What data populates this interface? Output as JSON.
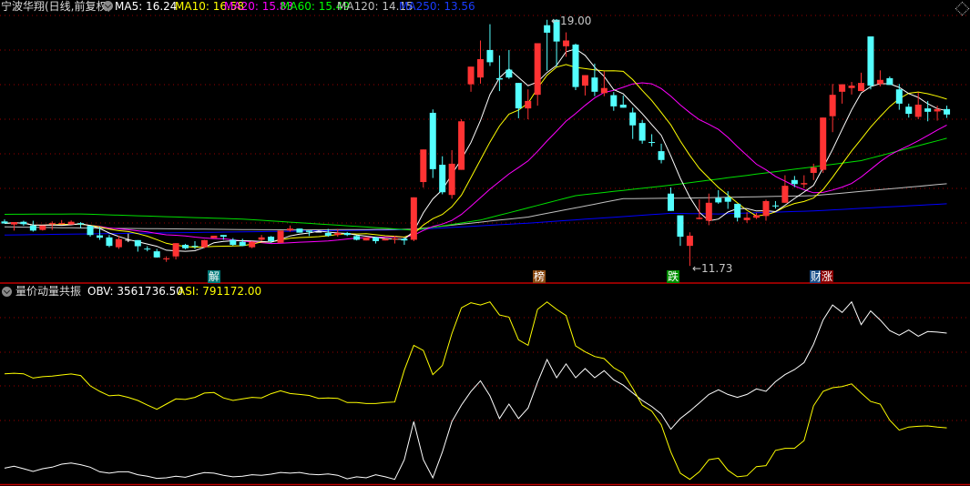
{
  "header": {
    "title": "宁波华翔(日线,前复权)",
    "ma_labels": [
      {
        "text": "MA5: 16.24",
        "color": "#ffffff"
      },
      {
        "text": "MA10: 16.58",
        "color": "#ffff00"
      },
      {
        "text": "MA20: 15.83",
        "color": "#ff00ff"
      },
      {
        "text": "MA60: 15.49",
        "color": "#00ff00"
      },
      {
        "text": "MA120: 14.15",
        "color": "#c0c0c0"
      },
      {
        "text": "MA250: 13.56",
        "color": "#0000ff"
      }
    ]
  },
  "indicator": {
    "title": "量价动量共振",
    "obv_label": "OBV: 3561736.50",
    "asi_label": "ASI: 791172.00"
  },
  "markers": {
    "high_label": "←19.00",
    "low_label": "←11.73",
    "badges": [
      {
        "text": "解",
        "bg": "#007a7a"
      },
      {
        "text": "榜",
        "bg": "#8b4a12"
      },
      {
        "text": "跌",
        "bg": "#009000"
      },
      {
        "text": "财",
        "bg": "#1a4f8a"
      },
      {
        "text": "涨",
        "bg": "#8b0000"
      }
    ]
  },
  "colors": {
    "up": "#ff3333",
    "down": "#54ffff",
    "flat": "#ffffff",
    "grid": "#9a0000",
    "separator": "#c00000"
  },
  "chart_data": [
    {
      "type": "candlestick",
      "title": "宁波华翔(日线,前复权)",
      "price_range": [
        11.73,
        19.0
      ],
      "high": 19.0,
      "low": 11.73,
      "ohlc": [
        [
          13.04,
          13.1,
          12.98,
          12.98
        ],
        [
          12.95,
          13.02,
          12.77,
          13.02
        ],
        [
          13.03,
          13.06,
          12.91,
          12.96
        ],
        [
          12.92,
          13.06,
          12.74,
          12.77
        ],
        [
          12.79,
          12.92,
          12.77,
          12.92
        ],
        [
          12.96,
          13.04,
          12.79,
          12.99
        ],
        [
          12.98,
          13.08,
          12.95,
          12.99
        ],
        [
          12.95,
          13.07,
          12.95,
          13.03
        ],
        [
          12.99,
          13.02,
          12.84,
          12.95
        ],
        [
          12.91,
          12.91,
          12.59,
          12.64
        ],
        [
          12.63,
          12.88,
          12.5,
          12.56
        ],
        [
          12.57,
          12.64,
          12.28,
          12.32
        ],
        [
          12.28,
          12.61,
          12.23,
          12.52
        ],
        [
          12.5,
          12.68,
          12.43,
          12.5
        ],
        [
          12.49,
          12.49,
          12.15,
          12.31
        ],
        [
          12.24,
          12.31,
          12.16,
          12.23
        ],
        [
          12.16,
          12.23,
          11.97,
          11.98
        ],
        [
          11.93,
          12.01,
          11.85,
          11.95
        ],
        [
          12.01,
          12.4,
          11.92,
          12.4
        ],
        [
          12.35,
          12.38,
          12.22,
          12.25
        ],
        [
          12.32,
          12.46,
          12.23,
          12.3
        ],
        [
          12.28,
          12.5,
          12.25,
          12.49
        ],
        [
          12.55,
          12.62,
          12.55,
          12.62
        ],
        [
          12.64,
          12.64,
          12.5,
          12.59
        ],
        [
          12.5,
          12.55,
          12.32,
          12.35
        ],
        [
          12.44,
          12.53,
          12.31,
          12.32
        ],
        [
          12.28,
          12.46,
          12.25,
          12.44
        ],
        [
          12.5,
          12.64,
          12.46,
          12.57
        ],
        [
          12.59,
          12.61,
          12.41,
          12.46
        ],
        [
          12.41,
          12.77,
          12.41,
          12.77
        ],
        [
          12.77,
          12.92,
          12.74,
          12.83
        ],
        [
          12.83,
          12.83,
          12.71,
          12.71
        ],
        [
          12.77,
          12.77,
          12.61,
          12.73
        ],
        [
          12.74,
          12.77,
          12.72,
          12.74
        ],
        [
          12.7,
          12.82,
          12.59,
          12.62
        ],
        [
          12.64,
          12.82,
          12.59,
          12.7
        ],
        [
          12.7,
          12.73,
          12.61,
          12.64
        ],
        [
          12.61,
          12.64,
          12.48,
          12.5
        ],
        [
          12.48,
          12.57,
          12.48,
          12.57
        ],
        [
          12.57,
          12.59,
          12.39,
          12.46
        ],
        [
          12.48,
          12.53,
          12.48,
          12.53
        ],
        [
          12.52,
          12.62,
          12.39,
          12.54
        ],
        [
          12.53,
          12.57,
          12.35,
          12.48
        ],
        [
          12.5,
          13.75,
          12.46,
          13.75
        ],
        [
          14.2,
          15.16,
          14.04,
          15.16
        ],
        [
          16.24,
          16.34,
          14.32,
          14.58
        ],
        [
          14.71,
          14.96,
          13.84,
          13.9
        ],
        [
          13.82,
          15.14,
          13.71,
          14.74
        ],
        [
          14.56,
          16.05,
          14.56,
          15.99
        ],
        [
          17.08,
          17.6,
          16.86,
          17.6
        ],
        [
          17.28,
          18.37,
          17.1,
          17.82
        ],
        [
          18.09,
          18.85,
          17.62,
          17.73
        ],
        [
          17.26,
          17.93,
          16.88,
          17.22
        ],
        [
          17.51,
          18.09,
          17.24,
          17.28
        ],
        [
          17.12,
          17.12,
          16.08,
          16.37
        ],
        [
          16.37,
          16.93,
          16.05,
          16.59
        ],
        [
          16.77,
          18.29,
          16.45,
          18.29
        ],
        [
          18.82,
          18.98,
          17.48,
          18.6
        ],
        [
          18.98,
          19.0,
          17.6,
          18.34
        ],
        [
          18.2,
          18.61,
          17.89,
          18.37
        ],
        [
          18.25,
          18.28,
          16.91,
          17.0
        ],
        [
          17.04,
          17.35,
          16.75,
          17.35
        ],
        [
          17.28,
          17.69,
          16.73,
          16.86
        ],
        [
          16.82,
          17.46,
          16.73,
          16.97
        ],
        [
          16.76,
          16.85,
          16.3,
          16.43
        ],
        [
          16.48,
          16.75,
          16.39,
          16.39
        ],
        [
          16.25,
          16.39,
          15.47,
          15.87
        ],
        [
          15.94,
          16.03,
          15.33,
          15.42
        ],
        [
          15.38,
          15.61,
          15.25,
          15.36
        ],
        [
          15.11,
          15.33,
          14.75,
          14.85
        ],
        [
          13.86,
          14.04,
          13.35,
          13.35
        ],
        [
          13.22,
          13.22,
          12.32,
          12.59
        ],
        [
          12.32,
          12.72,
          11.73,
          12.62
        ],
        [
          13.11,
          13.69,
          13.1,
          13.15
        ],
        [
          13.06,
          13.86,
          12.93,
          13.59
        ],
        [
          13.73,
          13.96,
          13.56,
          13.6
        ],
        [
          13.75,
          13.93,
          13.41,
          13.62
        ],
        [
          13.56,
          13.56,
          13.04,
          13.15
        ],
        [
          13.08,
          13.31,
          13.0,
          13.15
        ],
        [
          13.15,
          13.29,
          13.11,
          13.22
        ],
        [
          13.2,
          13.68,
          13.06,
          13.64
        ],
        [
          13.51,
          13.64,
          13.42,
          13.49
        ],
        [
          13.59,
          14.4,
          13.59,
          14.09
        ],
        [
          14.26,
          14.38,
          14.05,
          14.14
        ],
        [
          14.13,
          14.4,
          14.02,
          14.17
        ],
        [
          14.47,
          14.74,
          14.26,
          14.63
        ],
        [
          14.56,
          16.1,
          14.47,
          16.1
        ],
        [
          16.14,
          17.09,
          15.67,
          16.77
        ],
        [
          16.86,
          17.08,
          16.51,
          17.08
        ],
        [
          16.97,
          17.15,
          16.78,
          17.04
        ],
        [
          16.88,
          17.42,
          16.88,
          17.12
        ],
        [
          18.49,
          18.49,
          16.93,
          17.04
        ],
        [
          17.09,
          17.49,
          17.02,
          17.21
        ],
        [
          17.26,
          17.31,
          17.06,
          17.06
        ],
        [
          16.93,
          17.09,
          16.33,
          16.51
        ],
        [
          16.42,
          16.51,
          16.1,
          16.21
        ],
        [
          16.12,
          16.84,
          16.05,
          16.48
        ],
        [
          16.37,
          16.59,
          15.99,
          16.27
        ],
        [
          16.28,
          16.45,
          16.01,
          16.35
        ],
        [
          16.35,
          16.45,
          16.09,
          16.19
        ]
      ],
      "ma_long": {
        "MA60": [
          [
            0,
            13.25
          ],
          [
            8,
            13.26
          ],
          [
            25,
            13.11
          ],
          [
            40,
            12.84
          ],
          [
            43,
            12.78
          ],
          [
            50,
            13.08
          ],
          [
            60,
            13.8
          ],
          [
            70,
            14.11
          ],
          [
            80,
            14.47
          ],
          [
            90,
            14.83
          ],
          [
            99,
            15.49
          ]
        ],
        "MA120": [
          [
            0,
            12.88
          ],
          [
            10,
            12.84
          ],
          [
            30,
            12.79
          ],
          [
            43,
            12.81
          ],
          [
            55,
            13.17
          ],
          [
            65,
            13.71
          ],
          [
            72,
            13.73
          ],
          [
            85,
            13.8
          ],
          [
            99,
            14.15
          ]
        ],
        "MA250": [
          [
            0,
            12.64
          ],
          [
            43,
            12.8
          ],
          [
            55,
            12.99
          ],
          [
            70,
            13.28
          ],
          [
            75,
            13.26
          ],
          [
            85,
            13.35
          ],
          [
            99,
            13.56
          ]
        ]
      }
    },
    {
      "type": "line",
      "title": "量价动量共振",
      "units": "relative level 0-100",
      "series": [
        {
          "name": "OBV",
          "color": "#ffffff",
          "values": [
            8.3,
            9.3,
            8,
            6.6,
            8,
            8.8,
            10.4,
            11,
            10.1,
            8.8,
            6.4,
            5.7,
            6.4,
            6.4,
            4.9,
            4.1,
            3,
            3.3,
            4.1,
            3.6,
            4.9,
            6,
            5.7,
            4.6,
            3.8,
            4.1,
            4.9,
            4.6,
            5.2,
            6.1,
            5.7,
            6.1,
            5.2,
            4.9,
            5.3,
            4.6,
            2.8,
            3.8,
            3.3,
            4.9,
            3.8,
            2.5,
            12.7,
            32.4,
            12.7,
            3.3,
            16.7,
            32.4,
            41,
            48,
            53.6,
            45.8,
            34,
            41.5,
            34,
            39.5,
            52.8,
            64.6,
            55.2,
            62.3,
            55.2,
            59.9,
            55.2,
            58.8,
            54.1,
            51.3,
            47.3,
            43.4,
            40.3,
            36.3,
            28.5,
            34,
            37.9,
            42.1,
            46.5,
            48.9,
            46.5,
            45,
            46.5,
            49.4,
            48.1,
            53.1,
            56.8,
            59.4,
            63,
            72.5,
            85.1,
            92.9,
            89,
            94.5,
            82.7,
            89.8,
            85.1,
            79.6,
            77.2,
            79.9,
            76.7,
            79.1,
            78.8,
            78.3
          ]
        },
        {
          "name": "ASI",
          "color": "#ffff00",
          "values": [
            57.2,
            57.5,
            57.2,
            55,
            55.7,
            56,
            56.6,
            57.1,
            56.3,
            51,
            48.1,
            45.8,
            46.2,
            45,
            43.4,
            41,
            38.8,
            41.5,
            44.2,
            43.9,
            45,
            47.2,
            47.5,
            44.7,
            43.4,
            44.2,
            45,
            44.7,
            46.9,
            48.4,
            47,
            46.5,
            46,
            44.5,
            44.7,
            44.5,
            42.3,
            42.3,
            41.8,
            41.8,
            42.3,
            42.6,
            59.1,
            72,
            69.3,
            56.8,
            61.5,
            78,
            91.4,
            94,
            92.9,
            94.5,
            87.7,
            86.6,
            74.8,
            72,
            90.6,
            94.5,
            90.6,
            87.4,
            71.7,
            68.6,
            66.2,
            65.1,
            60.4,
            57.5,
            49.7,
            41,
            37.9,
            30.8,
            16.7,
            5.7,
            2.5,
            6.4,
            12.7,
            13.5,
            7.2,
            3.8,
            4.4,
            9.1,
            9.6,
            17.5,
            18.6,
            18.6,
            22.6,
            40.6,
            48.1,
            50,
            50.6,
            52,
            47.3,
            42.9,
            41.5,
            33.2,
            28,
            29.6,
            30,
            30.2,
            29.6,
            29.2
          ]
        }
      ]
    }
  ]
}
